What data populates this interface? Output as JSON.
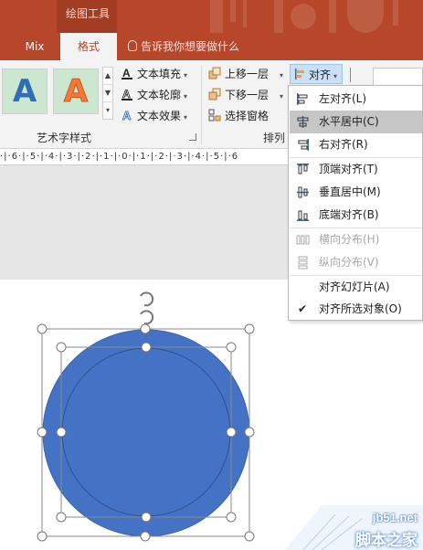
{
  "ribbon_context": {
    "label": "绘图工具"
  },
  "tabs": [
    {
      "label": "Mix"
    },
    {
      "label": "格式"
    }
  ],
  "tell_me": {
    "text": "告诉我你想要做什么"
  },
  "wordart_styles": {
    "group_label": "艺术字样式",
    "samples": [
      "A",
      "A"
    ],
    "text_fill": "文本填充",
    "text_outline": "文本轮廓",
    "text_effects": "文本效果"
  },
  "arrange": {
    "group_label": "排列",
    "bring_forward": "上移一层",
    "send_backward": "下移一层",
    "selection_pane": "选择窗格",
    "align_button": "对齐"
  },
  "ruler": {
    "text": "·|·6·|·5·|·4·|·3·|·2·|·1·|·0·|·1·|·2·|·3·|·4·|·5·|·6"
  },
  "align_menu": {
    "items": [
      {
        "label": "左对齐(L)",
        "icon": "align-left-icon",
        "state": "normal"
      },
      {
        "label": "水平居中(C)",
        "icon": "align-center-icon",
        "state": "highlighted"
      },
      {
        "label": "右对齐(R)",
        "icon": "align-right-icon",
        "state": "normal"
      },
      {
        "label": "顶端对齐(T)",
        "icon": "align-top-icon",
        "state": "normal"
      },
      {
        "label": "垂直居中(M)",
        "icon": "align-middle-icon",
        "state": "normal"
      },
      {
        "label": "底端对齐(B)",
        "icon": "align-bottom-icon",
        "state": "normal"
      },
      {
        "label": "横向分布(H)",
        "icon": "distribute-horizontal-icon",
        "state": "disabled"
      },
      {
        "label": "纵向分布(V)",
        "icon": "distribute-vertical-icon",
        "state": "disabled"
      },
      {
        "label": "对齐幻灯片(A)",
        "icon": "none",
        "state": "normal"
      },
      {
        "label": "对齐所选对象(O)",
        "icon": "checkmark-icon",
        "state": "checked"
      }
    ]
  },
  "watermark": {
    "url": "jb51.net",
    "name": "脚本之家"
  },
  "colors": {
    "brand": "#b7472a",
    "circle_fill": "#4472c4",
    "circle_stroke": "#2f528f",
    "menu_highlight": "#c6c6c6"
  }
}
